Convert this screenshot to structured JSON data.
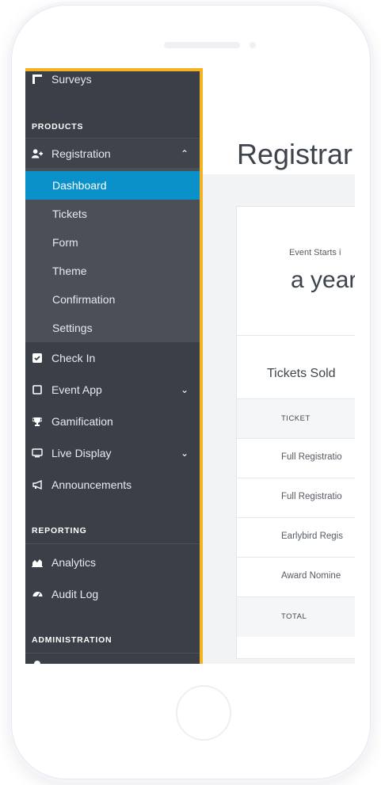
{
  "sidebar": {
    "top_item": {
      "label": "Surveys",
      "icon": "surveys-icon"
    },
    "sections": {
      "products": "PRODUCTS",
      "reporting": "REPORTING",
      "administration": "ADMINISTRATION"
    },
    "registration": {
      "label": "Registration",
      "expanded": true,
      "sub_items": [
        "Dashboard",
        "Tickets",
        "Form",
        "Theme",
        "Confirmation",
        "Settings"
      ],
      "active": "Dashboard"
    },
    "product_items": [
      {
        "label": "Check In",
        "icon": "check-in-icon"
      },
      {
        "label": "Event App",
        "icon": "mobile-icon",
        "chevron": "down"
      },
      {
        "label": "Gamification",
        "icon": "trophy-icon"
      },
      {
        "label": "Live Display",
        "icon": "monitor-icon",
        "chevron": "down"
      },
      {
        "label": "Announcements",
        "icon": "megaphone-icon"
      }
    ],
    "reporting_items": [
      {
        "label": "Analytics",
        "icon": "area-chart-icon"
      },
      {
        "label": "Audit Log",
        "icon": "dashboard-gauge-icon"
      }
    ],
    "accent_color": "#f5b324",
    "active_color": "#0b91c9"
  },
  "main": {
    "page_title": "Registrar",
    "event_starts_label": "Event Starts i",
    "event_starts_value": "a year",
    "tickets_sold_title": "Tickets Sold",
    "table": {
      "header": "TICKET",
      "rows": [
        "Full Registratio",
        "Full Registratio",
        "Earlybird Regis",
        "Award Nomine"
      ],
      "total": "TOTAL"
    }
  }
}
